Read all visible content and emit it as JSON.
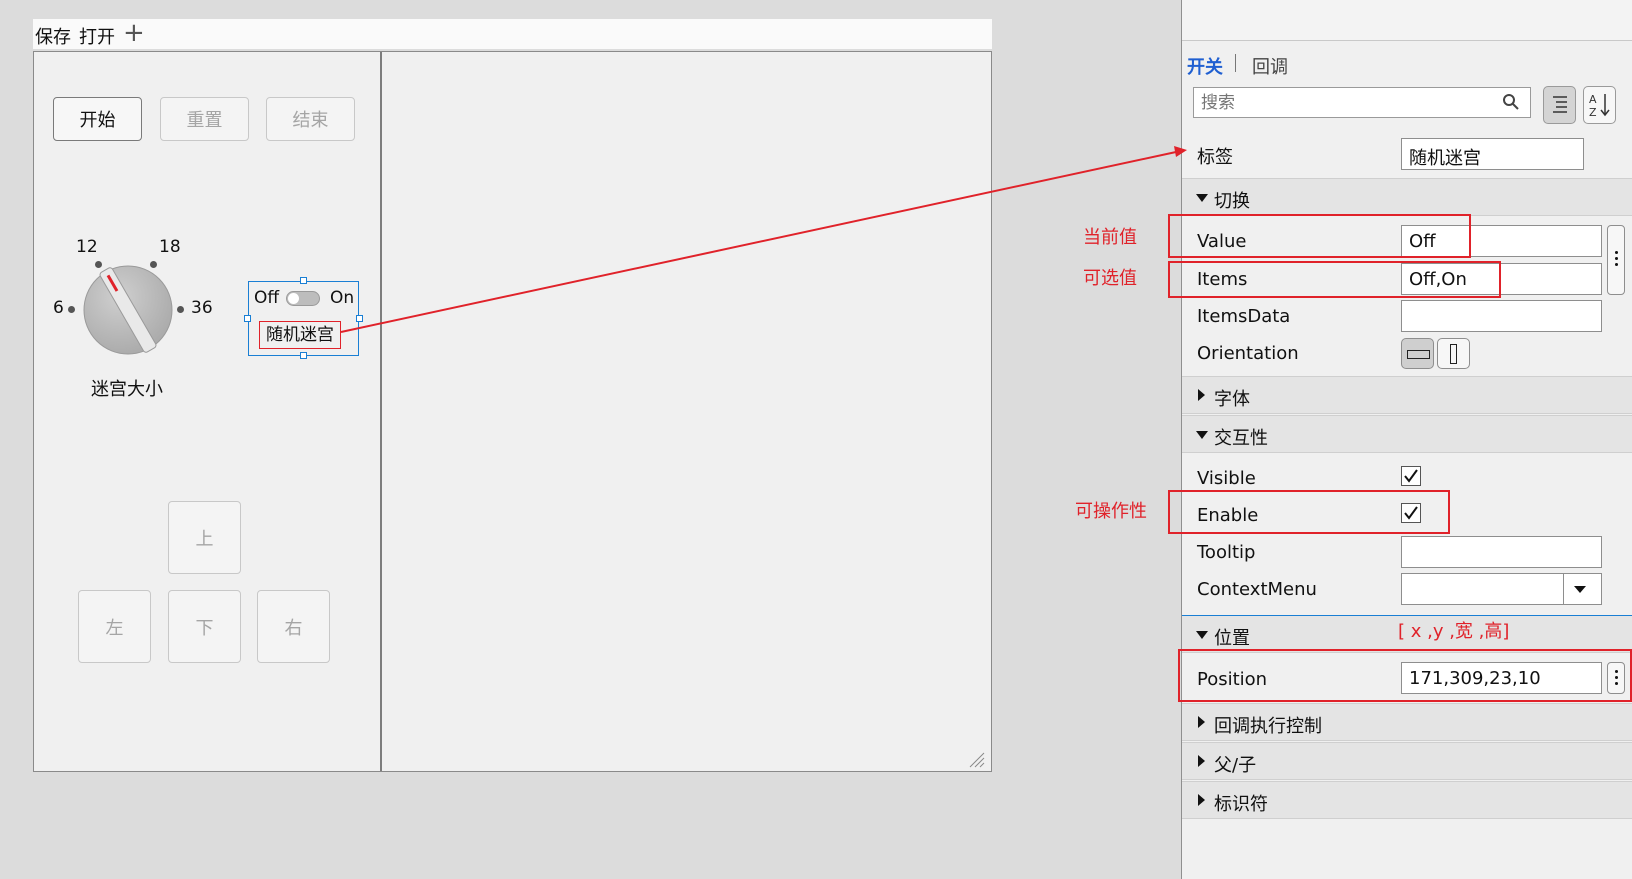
{
  "toolbar": {
    "save": "保存",
    "open": "打开",
    "add": "+"
  },
  "controls": {
    "start": "开始",
    "reset": "重置",
    "end": "结束",
    "up": "上",
    "left": "左",
    "down": "下",
    "right": "右"
  },
  "knob": {
    "labels": [
      "12",
      "18",
      "6",
      "36"
    ],
    "caption": "迷宫大小",
    "value": "12"
  },
  "switch": {
    "off": "Off",
    "on": "On",
    "label": "随机迷宫"
  },
  "panel": {
    "tabs": [
      "开关",
      "回调"
    ],
    "search_placeholder": "搜索",
    "label_name": "标签",
    "label_value": "随机迷宫",
    "sections": {
      "toggle": "切换",
      "font": "字体",
      "interactivity": "交互性",
      "position": "位置",
      "callback": "回调执行控制",
      "parent": "父/子",
      "identifier": "标识符"
    },
    "props": {
      "value": "Value",
      "value_val": "Off",
      "items": "Items",
      "items_val": "Off,On",
      "itemsdata": "ItemsData",
      "itemsdata_val": "",
      "orientation": "Orientation",
      "visible": "Visible",
      "enable": "Enable",
      "tooltip": "Tooltip",
      "tooltip_val": "",
      "contextmenu": "ContextMenu",
      "contextmenu_val": "",
      "position": "Position",
      "position_val": "171,309,23,10"
    },
    "checks": {
      "visible": true,
      "enable": true
    }
  },
  "annotations": {
    "current_value": "当前值",
    "options": "可选值",
    "operable": "可操作性",
    "xywh": "[ x ,y ,宽 ,高]"
  },
  "colors": {
    "accent": "#1f5fd1",
    "annotation": "#e0222a",
    "selection": "#1a7fd4"
  }
}
